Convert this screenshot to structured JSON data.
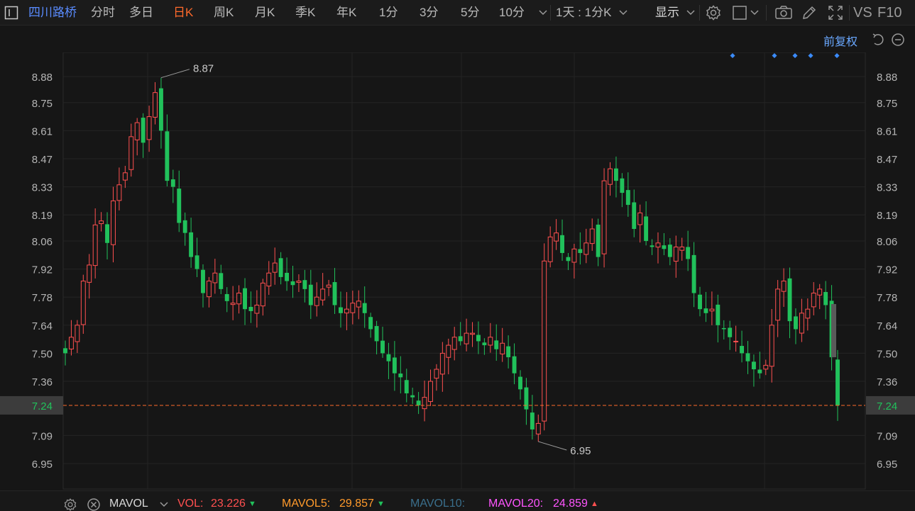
{
  "toolbar": {
    "stock_name": "四川路桥",
    "periods": [
      "分时",
      "多日",
      "日K",
      "周K",
      "月K",
      "季K",
      "年K",
      "1分",
      "3分",
      "5分",
      "10分"
    ],
    "active_period": "日K",
    "multi_period": "1天 : 1分K",
    "display_label": "显示",
    "vs_label": "VS",
    "f10_label": "F10",
    "icons": [
      "chevron-down-icon",
      "settings-icon",
      "checkbox-icon",
      "camera-icon",
      "pencil-icon",
      "fullscreen-icon"
    ]
  },
  "subbar": {
    "adjust_label": "前复权",
    "icons": [
      "undo-icon",
      "zoom-out-icon"
    ]
  },
  "chart": {
    "price_ticks": [
      "8.88",
      "8.75",
      "8.61",
      "8.47",
      "8.33",
      "8.19",
      "8.06",
      "7.92",
      "7.78",
      "7.64",
      "7.50",
      "7.36",
      "7.24",
      "7.09",
      "6.95"
    ],
    "current_price": "7.24",
    "high_label": "8.87",
    "low_label": "6.95",
    "colors": {
      "up": "#ff5050",
      "down": "#21c15b",
      "current": "#ff6a2b",
      "marker": "#3b8cff"
    }
  },
  "chart_data": {
    "type": "candlestick",
    "ylim": [
      6.88,
      8.98
    ],
    "y_ticks": [
      8.88,
      8.75,
      8.61,
      8.47,
      8.33,
      8.19,
      8.06,
      7.92,
      7.78,
      7.64,
      7.5,
      7.36,
      7.24,
      7.09,
      6.95
    ],
    "current_price": 7.24,
    "annotations": [
      {
        "text": "8.87",
        "value": 8.87
      },
      {
        "text": "6.95",
        "value": 6.95
      }
    ],
    "closes": [
      7.5,
      7.58,
      7.64,
      7.86,
      7.94,
      8.14,
      8.16,
      8.05,
      8.26,
      8.34,
      8.4,
      8.58,
      8.65,
      8.55,
      8.68,
      8.8,
      8.61,
      8.36,
      8.33,
      8.15,
      8.1,
      7.98,
      7.92,
      7.8,
      7.86,
      7.9,
      7.82,
      7.76,
      7.75,
      7.8,
      7.72,
      7.71,
      7.74,
      7.85,
      7.9,
      7.95,
      7.88,
      7.86,
      7.84,
      7.86,
      7.82,
      7.74,
      7.78,
      7.82,
      7.84,
      7.74,
      7.7,
      7.72,
      7.75,
      7.76,
      7.7,
      7.62,
      7.56,
      7.5,
      7.46,
      7.4,
      7.38,
      7.3,
      7.28,
      7.24,
      7.28,
      7.36,
      7.42,
      7.5,
      7.54,
      7.58,
      7.56,
      7.6,
      7.6,
      7.56,
      7.54,
      7.58,
      7.52,
      7.55,
      7.48,
      7.4,
      7.32,
      7.22,
      7.12,
      7.15,
      7.96,
      8.08,
      8.1,
      8.0,
      7.96,
      8.02,
      8.0,
      8.05,
      8.12,
      7.98,
      8.36,
      8.42,
      8.36,
      8.3,
      8.24,
      8.12,
      8.2,
      8.06,
      8.03,
      8.05,
      8.02,
      7.98,
      8.03,
      8.03,
      7.97,
      7.8,
      7.72,
      7.7,
      7.72,
      7.64,
      7.62,
      7.58,
      7.56,
      7.5,
      7.46,
      7.42,
      7.4,
      7.44,
      7.64,
      7.82,
      7.86,
      7.66,
      7.62,
      7.7,
      7.72,
      7.8,
      7.82,
      7.74,
      7.48,
      7.24
    ]
  },
  "toolbar_right_markers": 5,
  "indicator": {
    "name": "MAVOL",
    "vol_label": "VOL:",
    "vol_value": "23.226",
    "mavol5_label": "MAVOL5:",
    "mavol5_value": "29.857",
    "mavol10_label": "MAVOL10:",
    "mavol20_label": "MAVOL20:",
    "mavol20_value": "24.859",
    "colors": {
      "vol": "#ff5050",
      "mavol5": "#ff9a2b",
      "mavol10": "#3a6f8c",
      "mavol20": "#ff55ff"
    }
  }
}
